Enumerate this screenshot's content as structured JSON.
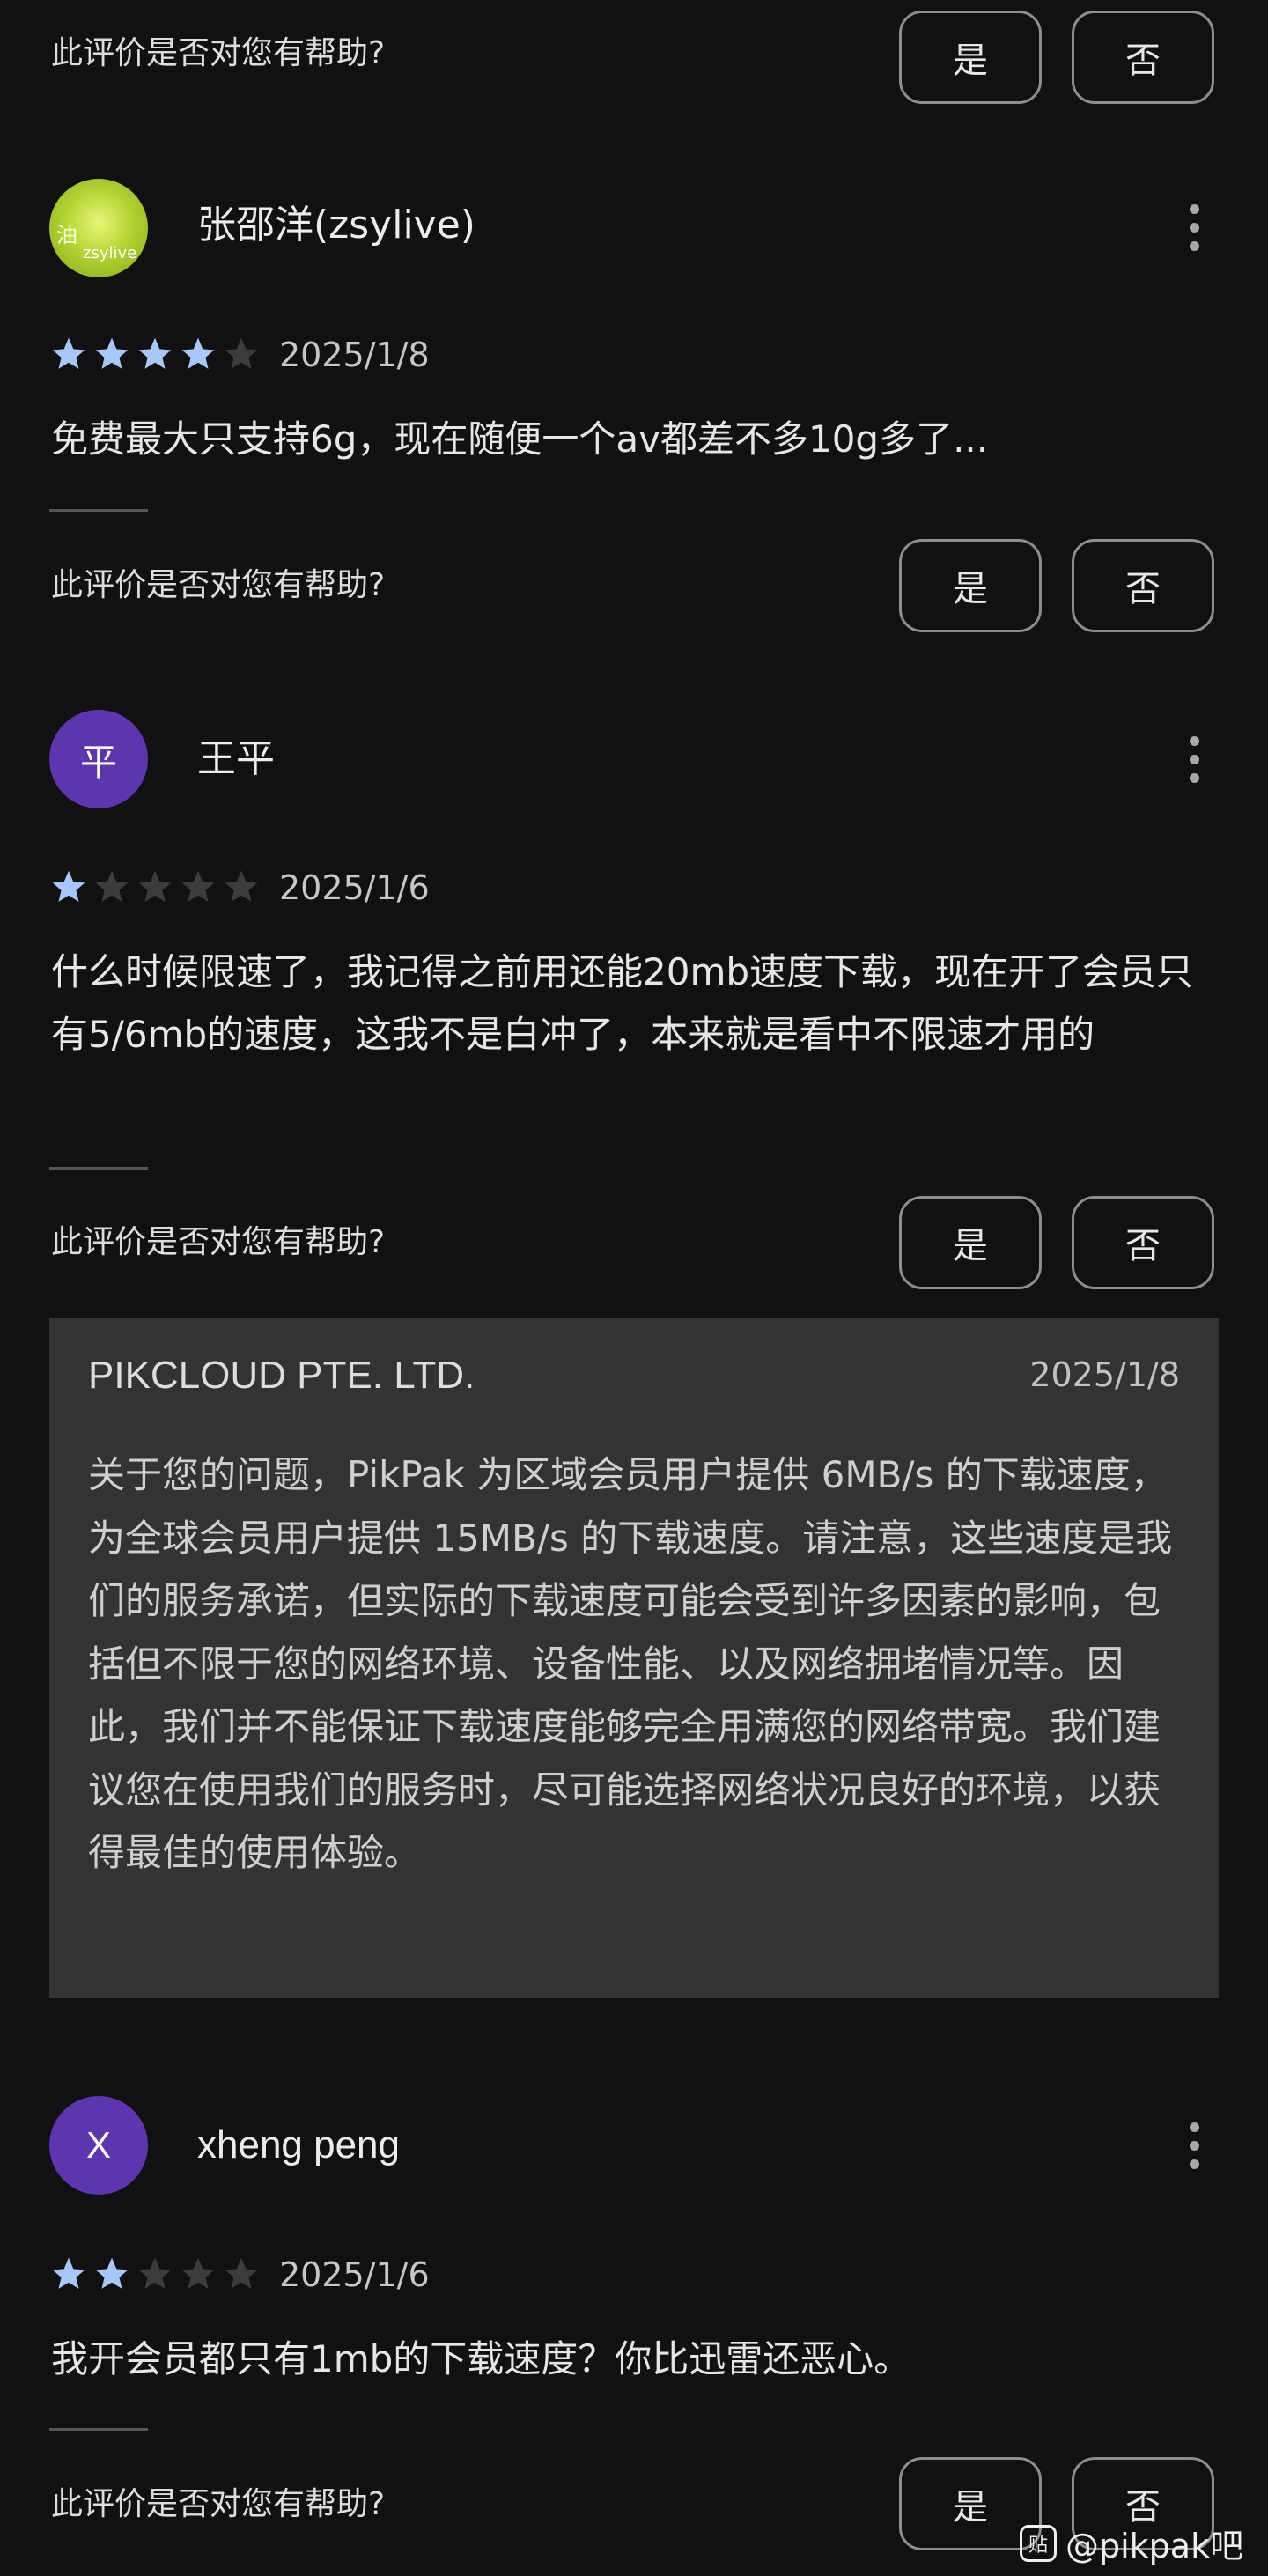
{
  "helpful_prompt": "此评价是否对您有帮助?",
  "yes_label": "是",
  "no_label": "否",
  "reviews": [
    {
      "author": "张邵洋(zsylive)",
      "avatar_text": "zsylive",
      "avatar_char": "油",
      "rating": 4,
      "date": "2025/1/8",
      "text": "免费最大只支持6g，现在随便一个av都差不多10g多了..."
    },
    {
      "author": "王平",
      "avatar_text": "平",
      "avatar_color": "#5e35b1",
      "rating": 1,
      "date": "2025/1/6",
      "text": "什么时候限速了，我记得之前用还能20mb速度下载，现在开了会员只有5/6mb的速度，这我不是白冲了，本来就是看中不限速才用的",
      "reply": {
        "author": "PIKCLOUD PTE. LTD.",
        "date": "2025/1/8",
        "text": "关于您的问题，PikPak 为区域会员用户提供 6MB/s 的下载速度，为全球会员用户提供 15MB/s 的下载速度。请注意，这些速度是我们的服务承诺，但实际的下载速度可能会受到许多因素的影响，包括但不限于您的网络环境、设备性能、以及网络拥堵情况等。因此，我们并不能保证下载速度能够完全用满您的网络带宽。我们建议您在使用我们的服务时，尽可能选择网络状况良好的环境，以获得最佳的使用体验。"
      }
    },
    {
      "author": "xheng peng",
      "avatar_text": "X",
      "avatar_color": "#5e35b1",
      "rating": 2,
      "date": "2025/1/6",
      "text": "我开会员都只有1mb的下载速度？你比迅雷还恶心。"
    }
  ],
  "colors": {
    "background": "#111111",
    "star_filled": "#a8c7fa",
    "star_empty": "#3c3c3c",
    "reply_bg": "#333333"
  },
  "watermark": {
    "icon_text": "贴",
    "text": "@pikpak吧"
  }
}
